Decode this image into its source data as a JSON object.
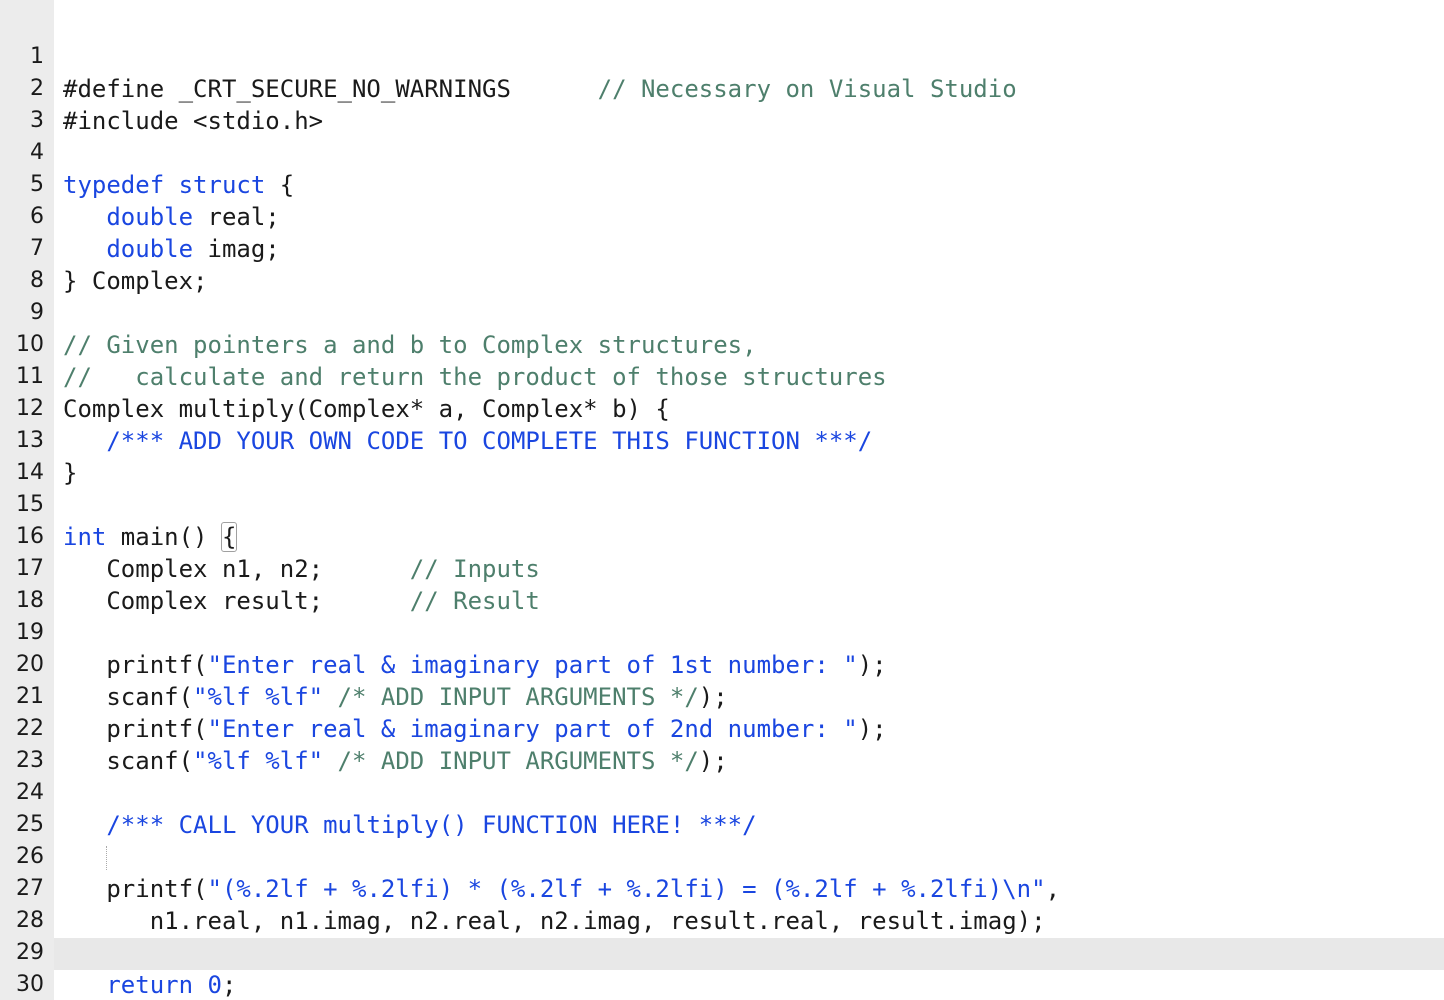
{
  "editor": {
    "colors": {
      "keyword": "#1a46e0",
      "string": "#1a46e0",
      "comment": "#4e7f6c",
      "text": "#1a1a1a",
      "gutter_bg": "#ececec",
      "current_line_bg": "#e8e8e8"
    },
    "current_line": "30",
    "lines": [
      {
        "n": "1",
        "t1": "#define _CRT_SECURE_NO_WARNINGS      ",
        "c1": "// Necessary on Visual Studio"
      },
      {
        "n": "2",
        "t1": "#include <stdio.h>"
      },
      {
        "n": "3"
      },
      {
        "n": "4",
        "k1": "typedef",
        "t1": " ",
        "k2": "struct",
        "t2": " {"
      },
      {
        "n": "5",
        "t0": "   ",
        "k1": "double",
        "t1": " real;"
      },
      {
        "n": "6",
        "t0": "   ",
        "k1": "double",
        "t1": " imag;"
      },
      {
        "n": "7",
        "t1": "} Complex;"
      },
      {
        "n": "8"
      },
      {
        "n": "9",
        "c1": "// Given pointers a and b to Complex structures,"
      },
      {
        "n": "10",
        "c1": "//   calculate and return the product of those structures"
      },
      {
        "n": "11",
        "t1": "Complex multiply(Complex* a, Complex* b) {"
      },
      {
        "n": "12",
        "t0": "   ",
        "b1": "/*** ADD YOUR OWN CODE TO COMPLETE THIS FUNCTION ***/"
      },
      {
        "n": "13",
        "t1": "}"
      },
      {
        "n": "14"
      },
      {
        "n": "15",
        "k1": "int",
        "t1": " main() ",
        "m1": "{"
      },
      {
        "n": "16",
        "t1": "   Complex n1, n2;      ",
        "c1": "// Inputs"
      },
      {
        "n": "17",
        "t1": "   Complex result;      ",
        "c1": "// Result"
      },
      {
        "n": "18"
      },
      {
        "n": "19",
        "t1": "   printf(",
        "s1": "\"Enter real & imaginary part of 1st number: \"",
        "t2": ");"
      },
      {
        "n": "20",
        "t1": "   scanf(",
        "s1": "\"%lf %lf\"",
        "t2": " ",
        "c1": "/* ADD INPUT ARGUMENTS */",
        "t3": ");"
      },
      {
        "n": "21",
        "t1": "   printf(",
        "s1": "\"Enter real & imaginary part of 2nd number: \"",
        "t2": ");"
      },
      {
        "n": "22",
        "t1": "   scanf(",
        "s1": "\"%lf %lf\"",
        "t2": " ",
        "c1": "/* ADD INPUT ARGUMENTS */",
        "t3": ");"
      },
      {
        "n": "23"
      },
      {
        "n": "24",
        "t0": "   ",
        "b1": "/*** CALL YOUR multiply() FUNCTION HERE! ***/"
      },
      {
        "n": "25"
      },
      {
        "n": "26",
        "t1": "   printf(",
        "s1": "\"(%.2lf + %.2lfi) * (%.2lf + %.2lfi) = (%.2lf + %.2lfi)\\n\"",
        "t2": ","
      },
      {
        "n": "27",
        "t1": "      n1.real, n1.imag, n2.real, n2.imag, result.real, result.imag);"
      },
      {
        "n": "28"
      },
      {
        "n": "29",
        "t0": "   ",
        "k1": "return",
        "t1": " ",
        "s1": "0",
        "t2": ";"
      },
      {
        "n": "30",
        "t1": "}"
      }
    ]
  }
}
